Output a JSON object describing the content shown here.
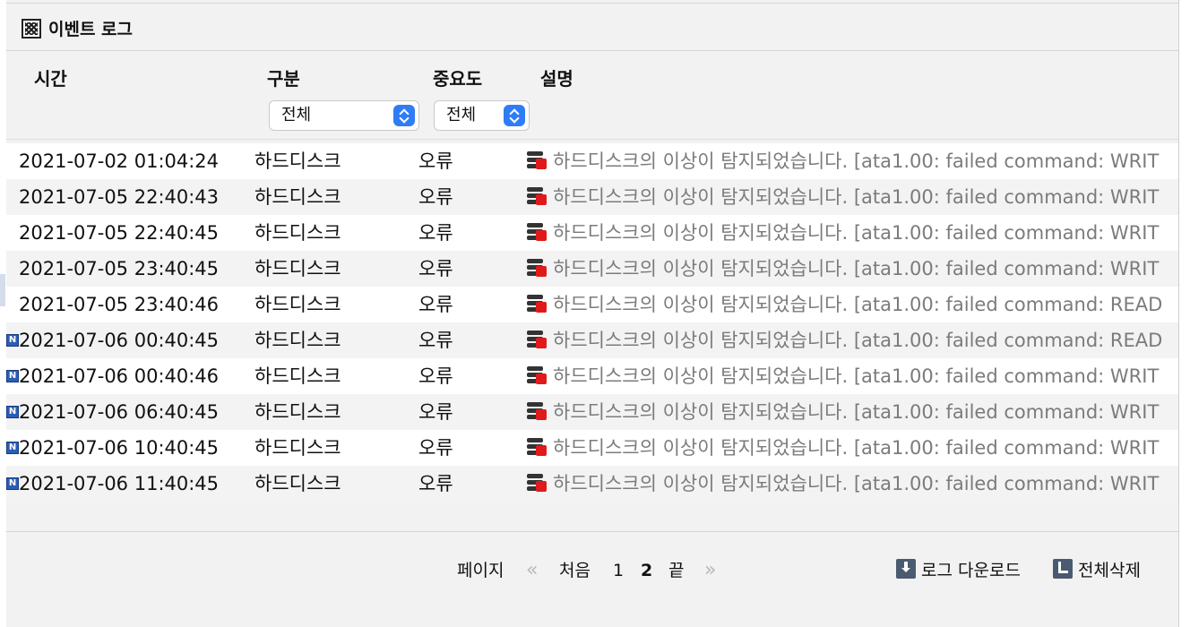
{
  "title": "이벤트 로그",
  "columns": {
    "time": "시간",
    "category": "구분",
    "severity": "중요도",
    "description": "설명"
  },
  "filters": {
    "category": "전체",
    "severity": "전체"
  },
  "rows": [
    {
      "time": "2021-07-02 01:04:24",
      "category": "하드디스크",
      "severity": "오류",
      "desc": "하드디스크의 이상이 탐지되었습니다. [ata1.00: failed command: WRIT"
    },
    {
      "time": "2021-07-05 22:40:43",
      "category": "하드디스크",
      "severity": "오류",
      "desc": "하드디스크의 이상이 탐지되었습니다. [ata1.00: failed command: WRIT"
    },
    {
      "time": "2021-07-05 22:40:45",
      "category": "하드디스크",
      "severity": "오류",
      "desc": "하드디스크의 이상이 탐지되었습니다. [ata1.00: failed command: WRIT"
    },
    {
      "time": "2021-07-05 23:40:45",
      "category": "하드디스크",
      "severity": "오류",
      "desc": "하드디스크의 이상이 탐지되었습니다. [ata1.00: failed command: WRIT"
    },
    {
      "time": "2021-07-05 23:40:46",
      "category": "하드디스크",
      "severity": "오류",
      "desc": "하드디스크의 이상이 탐지되었습니다. [ata1.00: failed command: READ"
    },
    {
      "time": "2021-07-06 00:40:45",
      "category": "하드디스크",
      "severity": "오류",
      "desc": "하드디스크의 이상이 탐지되었습니다. [ata1.00: failed command: READ"
    },
    {
      "time": "2021-07-06 00:40:46",
      "category": "하드디스크",
      "severity": "오류",
      "desc": "하드디스크의 이상이 탐지되었습니다. [ata1.00: failed command: WRIT"
    },
    {
      "time": "2021-07-06 06:40:45",
      "category": "하드디스크",
      "severity": "오류",
      "desc": "하드디스크의 이상이 탐지되었습니다. [ata1.00: failed command: WRIT"
    },
    {
      "time": "2021-07-06 10:40:45",
      "category": "하드디스크",
      "severity": "오류",
      "desc": "하드디스크의 이상이 탐지되었습니다. [ata1.00: failed command: WRIT"
    },
    {
      "time": "2021-07-06 11:40:45",
      "category": "하드디스크",
      "severity": "오류",
      "desc": "하드디스크의 이상이 탐지되었습니다. [ata1.00: failed command: WRIT"
    }
  ],
  "new_badge": "N",
  "pager": {
    "label": "페이지",
    "prev": "«",
    "first": "처음",
    "page1": "1",
    "page2": "2",
    "last": "끝",
    "next": "»"
  },
  "actions": {
    "download": "로그 다운로드",
    "delete_all": "전체삭제"
  },
  "colors": {
    "new_badge": "#2a5db5",
    "description_text": "#7b7b7b",
    "select_arrow": "#2f7cf6",
    "disk_warning": "#e01a1a"
  },
  "icons": {
    "title": "event-log-icon",
    "row": "disk-error-icon",
    "new": "new-badge-icon",
    "download": "download-icon",
    "delete": "delete-all-icon"
  }
}
